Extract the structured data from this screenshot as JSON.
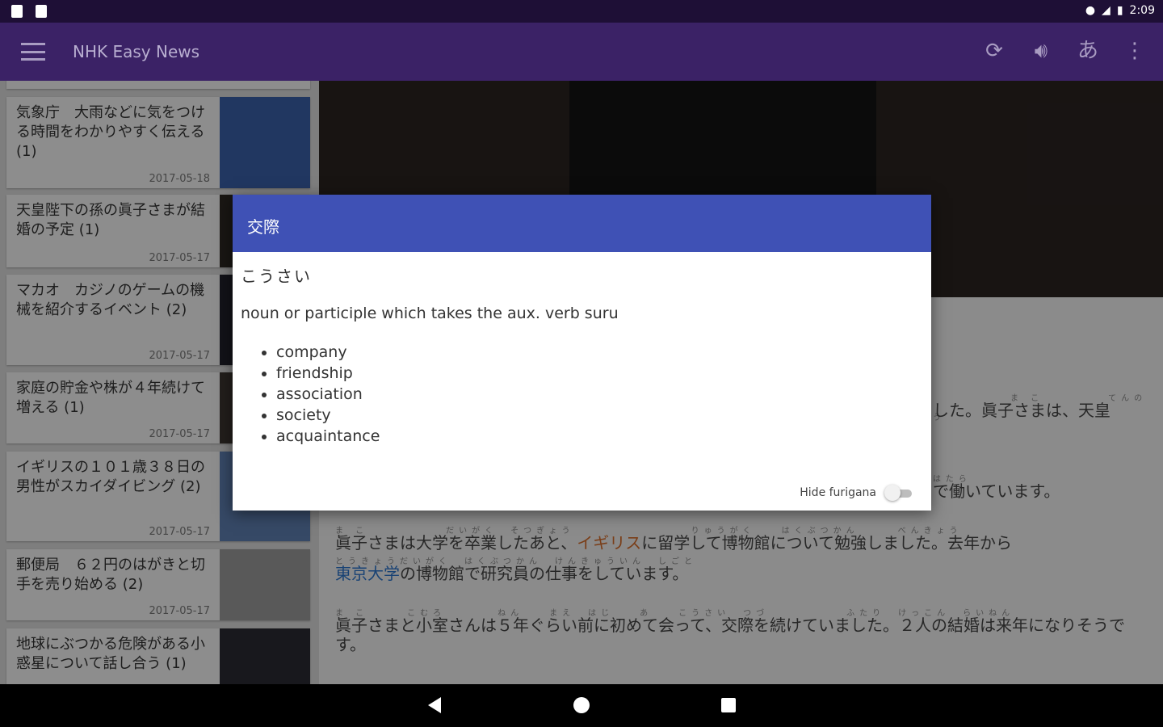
{
  "status_bar": {
    "time": "2:09"
  },
  "app_bar": {
    "title": "NHK Easy News",
    "actions": {
      "refresh": "refresh-icon",
      "audio": "volume-icon",
      "furigana": "あ",
      "more": "more-vert-icon"
    }
  },
  "articles": [
    {
      "title": "気象庁　大雨などに気をつける時間をわかりやすく伝える (1)",
      "date": "2017-05-18"
    },
    {
      "title": "天皇陛下の孫の眞子さまが結婚の予定 (1)",
      "date": "2017-05-17"
    },
    {
      "title": "マカオ　カジノのゲームの機械を紹介するイベント (2)",
      "date": "2017-05-17"
    },
    {
      "title": "家庭の貯金や株が４年続けて増える (1)",
      "date": "2017-05-17"
    },
    {
      "title": "イギリスの１０１歳３８日の男性がスカイダイビング (2)",
      "date": "2017-05-17"
    },
    {
      "title": "郵便局　６２円のはがきと切手を売り始める (2)",
      "date": "2017-05-17"
    },
    {
      "title": "地球にぶつかる危険がある小惑星について話し合う (1)",
      "date": ""
    }
  ],
  "article_body": {
    "p1_tail": "した。眞子さまは、天皇",
    "p2_tail": "で働いています。",
    "p3_a": "眞子さまは大学を卒業したあと、",
    "p3_b": "イギリス",
    "p3_c": "に留学して博物館について勉強しました。去年から",
    "p3_d": "東京大学",
    "p3_e": "の博物館で研究員の仕事をしています。",
    "p4": "眞子さまと小室さんは５年ぐらい前に初めて会って、交際を続けていました。２人の結婚は来年になりそうです。"
  },
  "dialog": {
    "word": "交際",
    "reading": "こうさい",
    "part_of_speech": "noun or participle which takes the aux. verb suru",
    "meanings": [
      "company",
      "friendship",
      "association",
      "society",
      "acquaintance"
    ],
    "toggle_label": "Hide furigana",
    "toggle_on": false
  },
  "colors": {
    "dialog_header": "#3f51b5",
    "app_bar": "#3b2266",
    "status_bar": "#1e0f36"
  }
}
